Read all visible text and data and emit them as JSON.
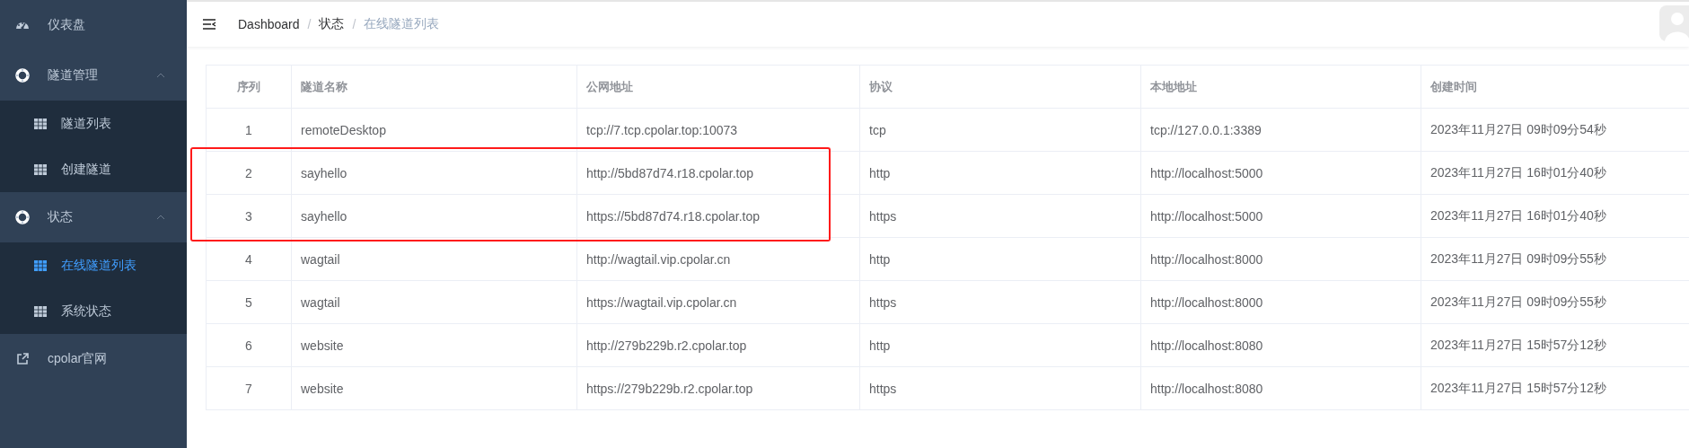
{
  "sidebar": {
    "items": [
      {
        "label": "仪表盘",
        "selected": false
      },
      {
        "label": "隧道管理",
        "expanded": true,
        "selected": false,
        "children": [
          {
            "label": "隧道列表",
            "selected": false
          },
          {
            "label": "创建隧道",
            "selected": false
          }
        ]
      },
      {
        "label": "状态",
        "expanded": true,
        "selected": false,
        "children": [
          {
            "label": "在线隧道列表",
            "selected": true
          },
          {
            "label": "系统状态",
            "selected": false
          }
        ]
      },
      {
        "label": "cpolar官网",
        "selected": false
      }
    ]
  },
  "breadcrumb": [
    {
      "label": "Dashboard",
      "current": false
    },
    {
      "separator": "/",
      "label": "状态",
      "current": false
    },
    {
      "separator": "/",
      "label": "在线隧道列表",
      "current": true
    }
  ],
  "table": {
    "columns": [
      "序列",
      "隧道名称",
      "公网地址",
      "协议",
      "本地地址",
      "创建时间"
    ],
    "rows": [
      {
        "cells": [
          "1",
          "remoteDesktop",
          "tcp://7.tcp.cpolar.top:10073",
          "tcp",
          "tcp://127.0.0.1:3389",
          "2023年11月27日 09时09分54秒"
        ],
        "highlighted": false
      },
      {
        "cells": [
          "2",
          "sayhello",
          "http://5bd87d74.r18.cpolar.top",
          "http",
          "http://localhost:5000",
          "2023年11月27日 16时01分40秒"
        ],
        "highlighted": true
      },
      {
        "cells": [
          "3",
          "sayhello",
          "https://5bd87d74.r18.cpolar.top",
          "https",
          "http://localhost:5000",
          "2023年11月27日 16时01分40秒"
        ],
        "highlighted": true
      },
      {
        "cells": [
          "4",
          "wagtail",
          "http://wagtail.vip.cpolar.cn",
          "http",
          "http://localhost:8000",
          "2023年11月27日 09时09分55秒"
        ],
        "highlighted": false
      },
      {
        "cells": [
          "5",
          "wagtail",
          "https://wagtail.vip.cpolar.cn",
          "https",
          "http://localhost:8000",
          "2023年11月27日 09时09分55秒"
        ],
        "highlighted": false
      },
      {
        "cells": [
          "6",
          "website",
          "http://279b229b.r2.cpolar.top",
          "http",
          "http://localhost:8080",
          "2023年11月27日 15时57分12秒"
        ],
        "highlighted": false
      },
      {
        "cells": [
          "7",
          "website",
          "https://279b229b.r2.cpolar.top",
          "https",
          "http://localhost:8080",
          "2023年11月27日 15时57分12秒"
        ],
        "highlighted": false
      }
    ]
  }
}
